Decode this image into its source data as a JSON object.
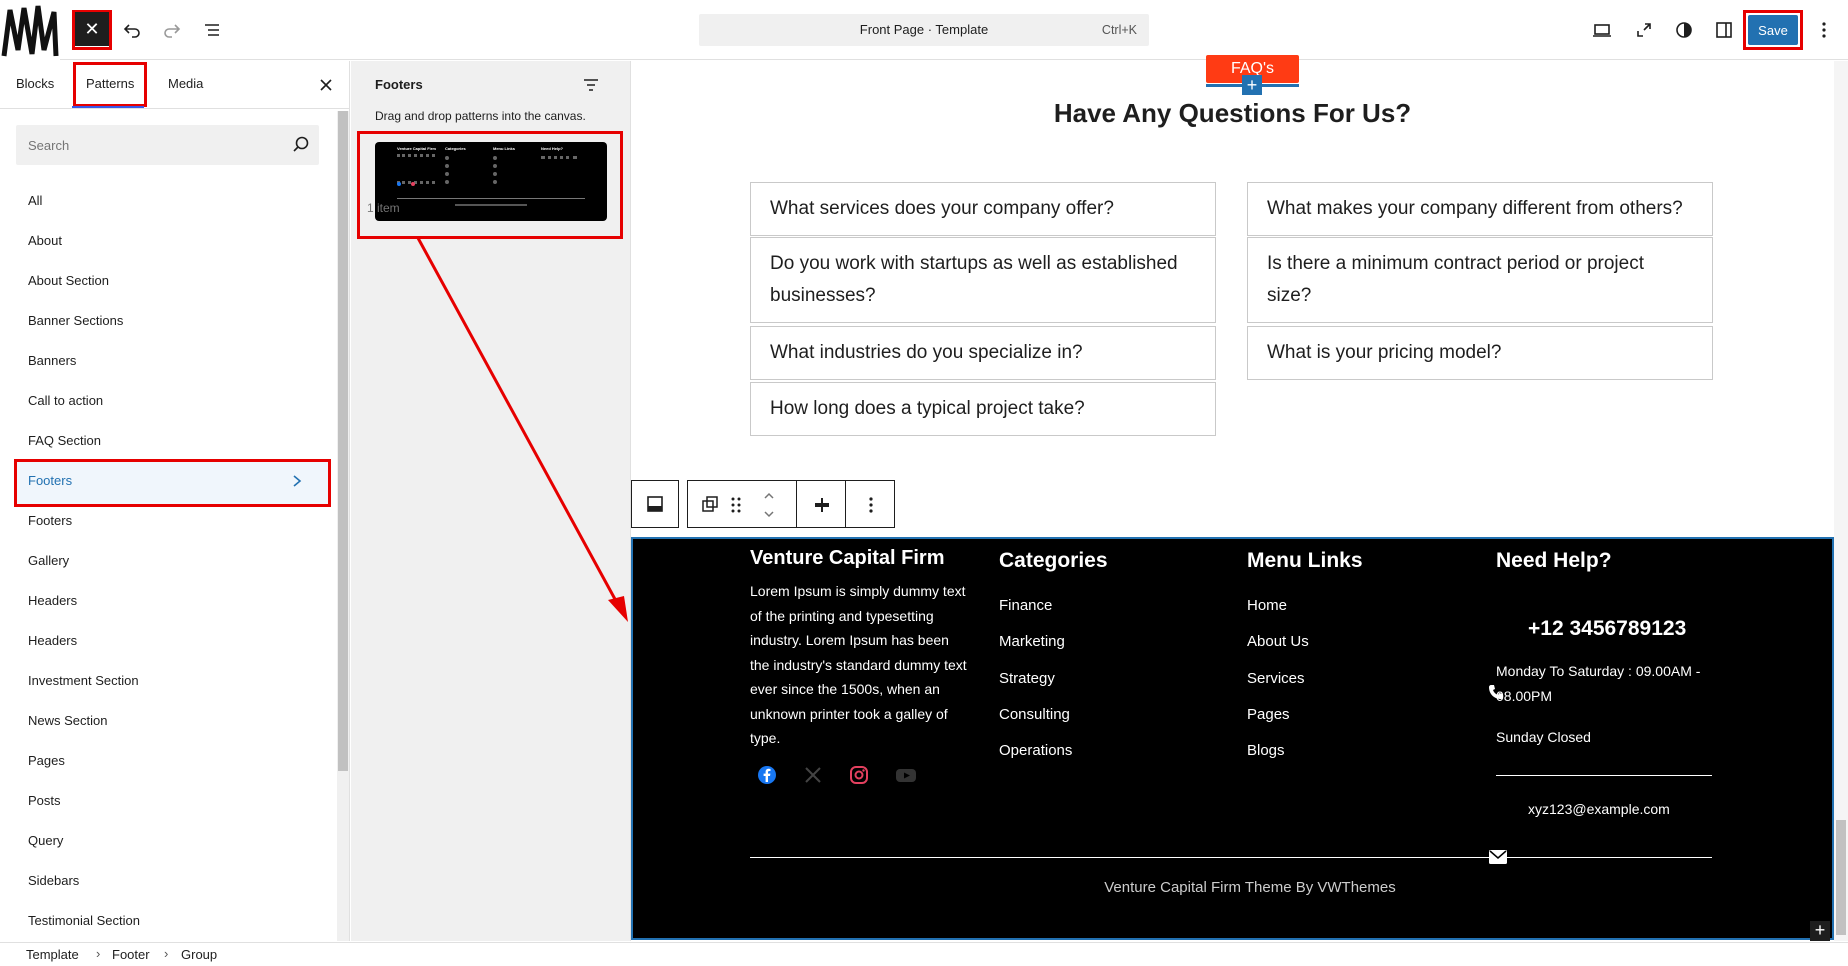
{
  "topbar": {
    "close_label": "✕",
    "command": {
      "title": "Front Page · Template",
      "shortcut": "Ctrl+K"
    },
    "save_label": "Save"
  },
  "left_panel": {
    "tabs": [
      "Blocks",
      "Patterns",
      "Media"
    ],
    "search_placeholder": "Search",
    "categories": [
      "All",
      "About",
      "About Section",
      "Banner Sections",
      "Banners",
      "Call to action",
      "FAQ Section",
      "Footers",
      "Footers",
      "Gallery",
      "Headers",
      "Headers",
      "Investment Section",
      "News Section",
      "Pages",
      "Posts",
      "Query",
      "Sidebars",
      "Testimonial Section"
    ],
    "active_category_index": 7
  },
  "patterns_panel": {
    "title": "Footers",
    "hint": "Drag and drop patterns into the canvas.",
    "count": "1 item",
    "thumb": {
      "col1_title": "Venture Capital Firm",
      "col2_title": "Categories",
      "col3_title": "Menu Links",
      "col4_title": "Need Help?"
    }
  },
  "canvas": {
    "faq_badge": "FAQ's",
    "faq_heading": "Have Any Questions For Us?",
    "faq_items": [
      "What services does your company offer?",
      "What makes your company different from others?",
      "Do you work with startups as well as established businesses?",
      "Is there a minimum contract period or project size?",
      "What industries do you specialize in?",
      "What is your pricing model?",
      "How long does a typical project take?"
    ]
  },
  "footer": {
    "about_title": "Venture Capital  Firm",
    "about_text": "Lorem Ipsum is simply dummy text of the printing and typesetting industry. Lorem Ipsum has been the industry's standard dummy text ever since the 1500s, when an unknown printer took a galley of type.",
    "categories_title": "Categories",
    "categories": [
      "Finance",
      "Marketing",
      "Strategy",
      "Consulting",
      "Operations"
    ],
    "menu_title": "Menu Links",
    "menu": [
      "Home",
      "About Us",
      "Services",
      "Pages",
      "Blogs"
    ],
    "help_title": "Need Help?",
    "phone": "+12 3456789123",
    "hours": "Monday To Saturday : 09.00AM - 08.00PM",
    "closed": "Sunday Closed",
    "email": "xyz123@example.com",
    "copyright": "Venture Capital Firm Theme By VWThemes",
    "social_colors": {
      "facebook": "#1877f2",
      "x": "#444444",
      "instagram": "#e4405f",
      "youtube": "#333333"
    }
  },
  "breadcrumbs": [
    "Template",
    "Footer",
    "Group"
  ],
  "colors": {
    "accent": "#2271b1",
    "highlight": "#e60000",
    "faq_badge": "#ff3b14"
  }
}
